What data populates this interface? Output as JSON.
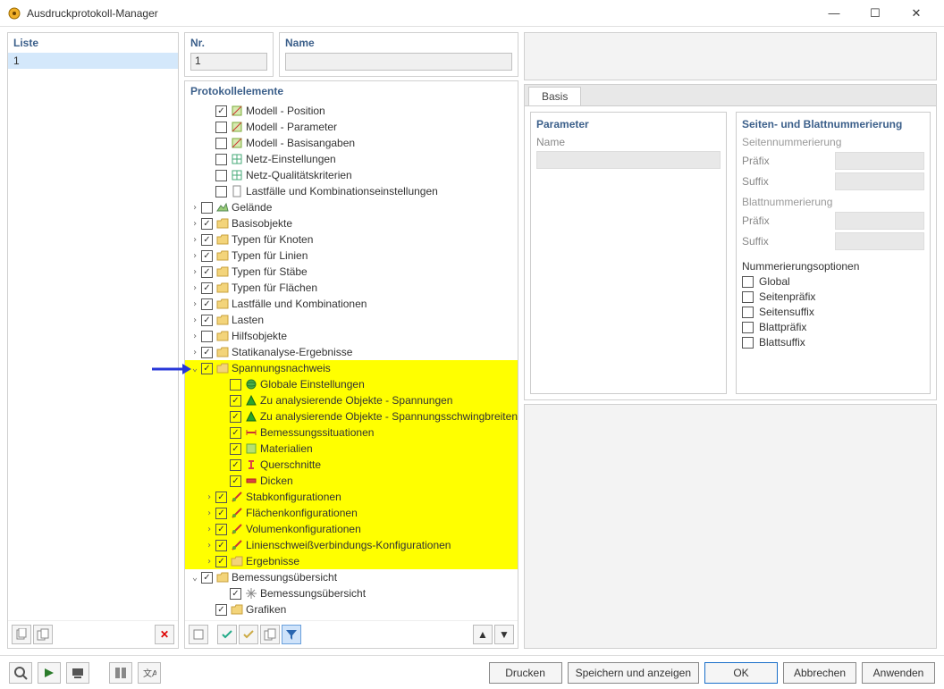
{
  "window": {
    "title": "Ausdruckprotokoll-Manager"
  },
  "liste": {
    "header": "Liste",
    "items": [
      "1"
    ]
  },
  "nr": {
    "header": "Nr.",
    "value": "1"
  },
  "name": {
    "header": "Name",
    "value": ""
  },
  "proto_header": "Protokollelemente",
  "tree": [
    {
      "indent": 1,
      "expander": "",
      "checked": true,
      "icon": "model",
      "label": "Modell - Position",
      "hl": false
    },
    {
      "indent": 1,
      "expander": "",
      "checked": false,
      "icon": "model",
      "label": "Modell - Parameter",
      "hl": false
    },
    {
      "indent": 1,
      "expander": "",
      "checked": false,
      "icon": "model",
      "label": "Modell - Basisangaben",
      "hl": false
    },
    {
      "indent": 1,
      "expander": "",
      "checked": false,
      "icon": "mesh",
      "label": "Netz-Einstellungen",
      "hl": false
    },
    {
      "indent": 1,
      "expander": "",
      "checked": false,
      "icon": "mesh",
      "label": "Netz-Qualitätskriterien",
      "hl": false
    },
    {
      "indent": 1,
      "expander": "",
      "checked": false,
      "icon": "page",
      "label": "Lastfälle und Kombinationseinstellungen",
      "hl": false
    },
    {
      "indent": 0,
      "expander": ">",
      "checked": false,
      "icon": "terrain",
      "label": "Gelände",
      "hl": false
    },
    {
      "indent": 0,
      "expander": ">",
      "checked": true,
      "icon": "folder",
      "label": "Basisobjekte",
      "hl": false
    },
    {
      "indent": 0,
      "expander": ">",
      "checked": true,
      "icon": "folder",
      "label": "Typen für Knoten",
      "hl": false
    },
    {
      "indent": 0,
      "expander": ">",
      "checked": true,
      "icon": "folder",
      "label": "Typen für Linien",
      "hl": false
    },
    {
      "indent": 0,
      "expander": ">",
      "checked": true,
      "icon": "folder",
      "label": "Typen für Stäbe",
      "hl": false
    },
    {
      "indent": 0,
      "expander": ">",
      "checked": true,
      "icon": "folder",
      "label": "Typen für Flächen",
      "hl": false
    },
    {
      "indent": 0,
      "expander": ">",
      "checked": true,
      "icon": "folder",
      "label": "Lastfälle und Kombinationen",
      "hl": false
    },
    {
      "indent": 0,
      "expander": ">",
      "checked": true,
      "icon": "folder",
      "label": "Lasten",
      "hl": false
    },
    {
      "indent": 0,
      "expander": ">",
      "checked": false,
      "icon": "folder",
      "label": "Hilfsobjekte",
      "hl": false
    },
    {
      "indent": 0,
      "expander": ">",
      "checked": true,
      "icon": "folder",
      "label": "Statikanalyse-Ergebnisse",
      "hl": false
    },
    {
      "indent": 0,
      "expander": "∨",
      "checked": true,
      "icon": "folder",
      "label": "Spannungsnachweis",
      "hl": true
    },
    {
      "indent": 2,
      "expander": "",
      "checked": false,
      "icon": "globe",
      "label": "Globale Einstellungen",
      "hl": true
    },
    {
      "indent": 2,
      "expander": "",
      "checked": true,
      "icon": "green",
      "label": "Zu analysierende Objekte - Spannungen",
      "hl": true
    },
    {
      "indent": 2,
      "expander": "",
      "checked": true,
      "icon": "green",
      "label": "Zu analysierende Objekte - Spannungsschwingbreiten",
      "hl": true
    },
    {
      "indent": 2,
      "expander": "",
      "checked": true,
      "icon": "dim",
      "label": "Bemessungssituationen",
      "hl": true
    },
    {
      "indent": 2,
      "expander": "",
      "checked": true,
      "icon": "mat",
      "label": "Materialien",
      "hl": true
    },
    {
      "indent": 2,
      "expander": "",
      "checked": true,
      "icon": "qs",
      "label": "Querschnitte",
      "hl": true
    },
    {
      "indent": 2,
      "expander": "",
      "checked": true,
      "icon": "th",
      "label": "Dicken",
      "hl": true
    },
    {
      "indent": 1,
      "expander": ">",
      "checked": true,
      "icon": "cfg",
      "label": "Stabkonfigurationen",
      "hl": true
    },
    {
      "indent": 1,
      "expander": ">",
      "checked": true,
      "icon": "cfg",
      "label": "Flächenkonfigurationen",
      "hl": true
    },
    {
      "indent": 1,
      "expander": ">",
      "checked": true,
      "icon": "cfg",
      "label": "Volumenkonfigurationen",
      "hl": true
    },
    {
      "indent": 1,
      "expander": ">",
      "checked": true,
      "icon": "cfg",
      "label": "Linienschweißverbindungs-Konfigurationen",
      "hl": true
    },
    {
      "indent": 1,
      "expander": ">",
      "checked": true,
      "icon": "folder",
      "label": "Ergebnisse",
      "hl": true
    },
    {
      "indent": 0,
      "expander": "∨",
      "checked": true,
      "icon": "folder",
      "label": "Bemessungsübersicht",
      "hl": false
    },
    {
      "indent": 2,
      "expander": "",
      "checked": true,
      "icon": "snow",
      "label": "Bemessungsübersicht",
      "hl": false
    },
    {
      "indent": 1,
      "expander": "",
      "checked": true,
      "icon": "folder",
      "label": "Grafiken",
      "hl": false
    }
  ],
  "tabs": {
    "basis": "Basis"
  },
  "param": {
    "header": "Parameter",
    "name_label": "Name"
  },
  "numbering": {
    "header": "Seiten- und Blattnummerierung",
    "page_section": "Seitennummerierung",
    "prefix": "Präfix",
    "suffix": "Suffix",
    "sheet_section": "Blattnummerierung",
    "options_header": "Nummerierungsoptionen",
    "opts": {
      "global": "Global",
      "page_prefix": "Seitenpräfix",
      "page_suffix": "Seitensuffix",
      "sheet_prefix": "Blattpräfix",
      "sheet_suffix": "Blattsuffix"
    }
  },
  "buttons": {
    "print": "Drucken",
    "save_show": "Speichern und anzeigen",
    "ok": "OK",
    "cancel": "Abbrechen",
    "apply": "Anwenden"
  }
}
